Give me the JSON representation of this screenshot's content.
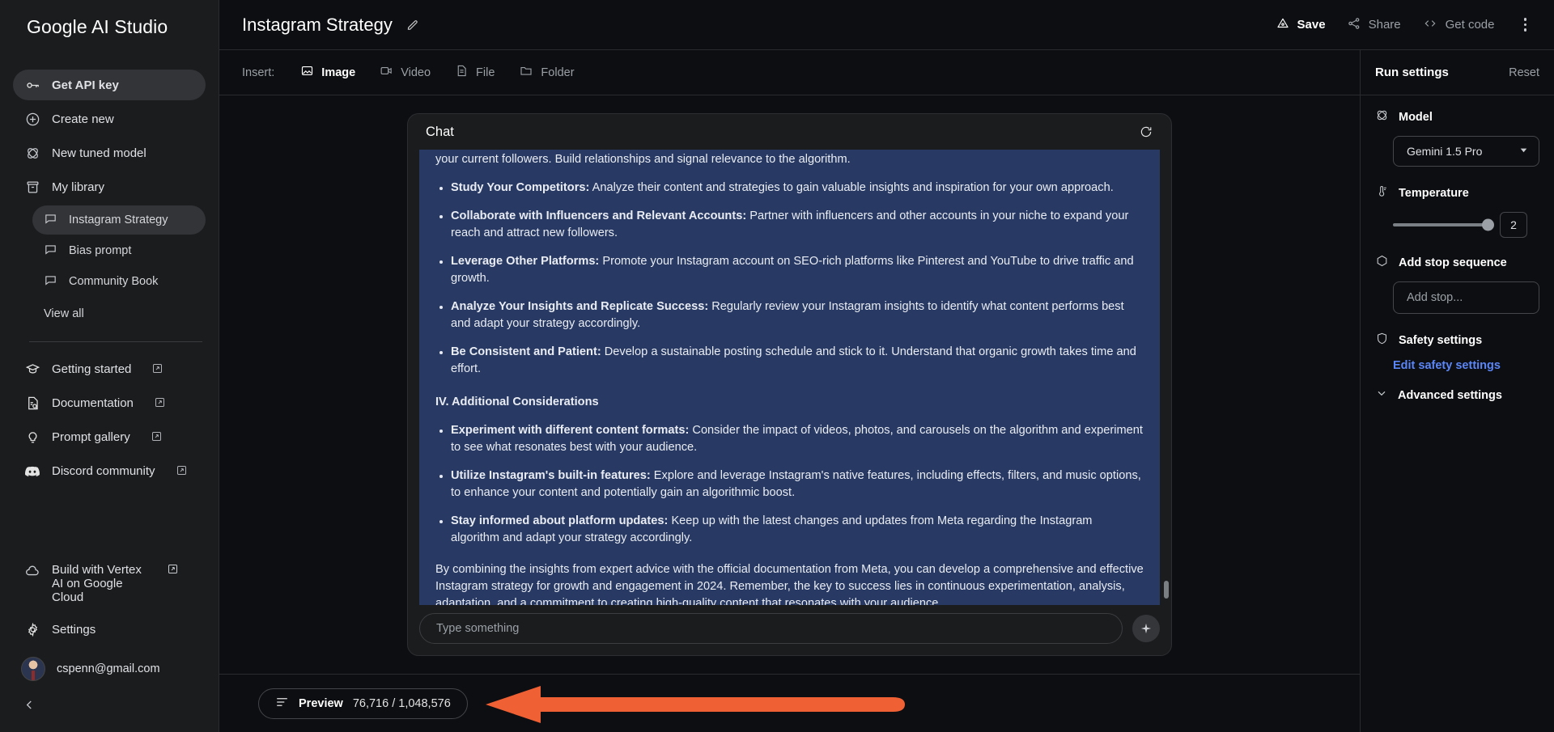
{
  "sidebar": {
    "brand": "Google AI Studio",
    "primary": [
      {
        "label": "Get API key",
        "icon": "key-icon"
      },
      {
        "label": "Create new",
        "icon": "plus-circle-icon"
      },
      {
        "label": "New tuned model",
        "icon": "atom-icon"
      },
      {
        "label": "My library",
        "icon": "archive-icon"
      }
    ],
    "library": [
      {
        "label": "Instagram Strategy",
        "icon": "chat-bubble-icon"
      },
      {
        "label": "Bias prompt",
        "icon": "chat-bubble-icon"
      },
      {
        "label": "Community Book",
        "icon": "chat-bubble-icon"
      }
    ],
    "view_all": "View all",
    "links": [
      {
        "label": "Getting started",
        "icon": "graduation-cap-icon"
      },
      {
        "label": "Documentation",
        "icon": "document-search-icon"
      },
      {
        "label": "Prompt gallery",
        "icon": "lightbulb-icon"
      },
      {
        "label": "Discord community",
        "icon": "discord-icon"
      }
    ],
    "vertex": "Build with Vertex AI on Google Cloud",
    "settings": "Settings",
    "account_email": "cspenn@gmail.com"
  },
  "header": {
    "title": "Instagram Strategy",
    "actions": [
      {
        "label": "Save",
        "icon": "save-icon"
      },
      {
        "label": "Share",
        "icon": "share-icon"
      },
      {
        "label": "Get code",
        "icon": "code-icon"
      }
    ]
  },
  "insert_bar": {
    "label": "Insert:",
    "items": [
      {
        "label": "Image",
        "icon": "image-icon",
        "active": true
      },
      {
        "label": "Video",
        "icon": "video-icon",
        "active": false
      },
      {
        "label": "File",
        "icon": "file-icon",
        "active": false
      },
      {
        "label": "Folder",
        "icon": "folder-icon",
        "active": false
      }
    ]
  },
  "chat": {
    "title": "Chat",
    "bubble": {
      "truncated_line": "your current followers. Build relationships and signal relevance to the algorithm.",
      "bullets_1": [
        {
          "lead": "Study Your Competitors:",
          "text": " Analyze their content and strategies to gain valuable insights and inspiration for your own approach."
        },
        {
          "lead": "Collaborate with Influencers and Relevant Accounts:",
          "text": " Partner with influencers and other accounts in your niche to expand your reach and attract new followers."
        },
        {
          "lead": "Leverage Other Platforms:",
          "text": " Promote your Instagram account on SEO-rich platforms like Pinterest and YouTube to drive traffic and growth."
        },
        {
          "lead": "Analyze Your Insights and Replicate Success:",
          "text": " Regularly review your Instagram insights to identify what content performs best and adapt your strategy accordingly."
        },
        {
          "lead": "Be Consistent and Patient:",
          "text": " Develop a sustainable posting schedule and stick to it. Understand that organic growth takes time and effort."
        }
      ],
      "section_heading": "IV. Additional Considerations",
      "bullets_2": [
        {
          "lead": "Experiment with different content formats:",
          "text": " Consider the impact of videos, photos, and carousels on the algorithm and experiment to see what resonates best with your audience."
        },
        {
          "lead": "Utilize Instagram's built-in features:",
          "text": " Explore and leverage Instagram's native features, including effects, filters, and music options, to enhance your content and potentially gain an algorithmic boost."
        },
        {
          "lead": "Stay informed about platform updates:",
          "text": " Keep up with the latest changes and updates from Meta regarding the Instagram algorithm and adapt your strategy accordingly."
        }
      ],
      "closing": "By combining the insights from expert advice with the official documentation from Meta, you can develop a comprehensive and effective Instagram strategy for growth and engagement in 2024. Remember, the key to success lies in continuous experimentation, analysis, adaptation, and a commitment to creating high-quality content that resonates with your audience."
    },
    "composer_placeholder": "Type something"
  },
  "footer": {
    "preview_label": "Preview",
    "token_count": "76,716 / 1,048,576"
  },
  "run_settings": {
    "title": "Run settings",
    "reset": "Reset",
    "model_label": "Model",
    "model_value": "Gemini 1.5 Pro",
    "temperature_label": "Temperature",
    "temperature_value": "2",
    "stop_label": "Add stop sequence",
    "stop_placeholder": "Add stop...",
    "safety_label": "Safety settings",
    "edit_safety": "Edit safety settings",
    "advanced_label": "Advanced settings"
  },
  "colors": {
    "accent_arrow": "#ef6034",
    "bubble": "#283a63",
    "link": "#5b86f7",
    "sidebar_bg": "#1b1c1e"
  }
}
